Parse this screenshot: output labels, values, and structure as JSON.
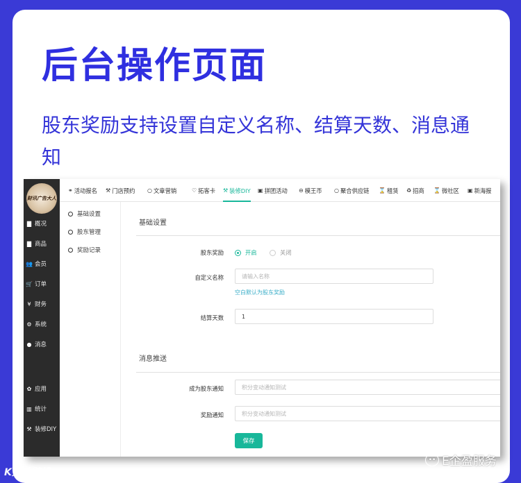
{
  "headline": "后台操作页面",
  "subline": "股东奖励支持设置自定义名称、结算天数、消息通知",
  "logo_text": "财讯广告大人",
  "sidebar": {
    "items": [
      {
        "label": "概况",
        "icon": "overview-icon",
        "glyph": "▇"
      },
      {
        "label": "商品",
        "icon": "goods-icon",
        "glyph": "▇"
      },
      {
        "label": "会员",
        "icon": "members-icon",
        "glyph": "👥"
      },
      {
        "label": "订单",
        "icon": "cart-icon",
        "glyph": "🛒"
      },
      {
        "label": "财务",
        "icon": "yen-icon",
        "glyph": "¥"
      },
      {
        "label": "系统",
        "icon": "gear-icon",
        "glyph": "⚙"
      },
      {
        "label": "消息",
        "icon": "chat-icon",
        "glyph": "●"
      },
      {
        "label": "应用",
        "icon": "apps-icon",
        "glyph": "✿"
      },
      {
        "label": "统计",
        "icon": "bar-chart-icon",
        "glyph": "▥"
      },
      {
        "label": "装修DIY",
        "icon": "hammer-icon",
        "glyph": "⚒"
      }
    ]
  },
  "tabs": [
    {
      "label": "活动报名",
      "icon": "link-icon",
      "glyph": "⚭"
    },
    {
      "label": "门店预约",
      "icon": "hammer-icon",
      "glyph": "⚒"
    },
    {
      "label": "文章营销",
      "icon": "circle-icon",
      "glyph": "○"
    },
    {
      "label": "拓客卡",
      "icon": "heart-icon",
      "glyph": "♡"
    },
    {
      "label": "装修DIY",
      "icon": "hammer-icon",
      "glyph": "⚒",
      "active": true
    },
    {
      "label": "拼团活动",
      "icon": "image-icon",
      "glyph": "▣"
    },
    {
      "label": "模王币",
      "icon": "coin-icon",
      "glyph": "⊖"
    },
    {
      "label": "聚合供应链",
      "icon": "circle-icon",
      "glyph": "○"
    },
    {
      "label": "租赁",
      "icon": "hourglass-icon",
      "glyph": "⌛"
    },
    {
      "label": "招商",
      "icon": "recycle-icon",
      "glyph": "♻"
    },
    {
      "label": "微社区",
      "icon": "hourglass-icon",
      "glyph": "⌛"
    },
    {
      "label": "新海报",
      "icon": "image-icon",
      "glyph": "▣"
    }
  ],
  "subnav": [
    "基础设置",
    "股东管理",
    "奖励记录"
  ],
  "basic": {
    "title": "基础设置",
    "reward_label": "股东奖励",
    "on_label": "开启",
    "off_label": "关闭",
    "name_label": "自定义名称",
    "name_placeholder": "请输入名称",
    "name_hint": "空白默认为股东奖励",
    "days_label": "结算天数",
    "days_value": "1"
  },
  "push": {
    "title": "消息推送",
    "become_label": "成为股东通知",
    "become_value": "积分变动通知测试",
    "reward_label": "奖励通知",
    "reward_value": "积分变动通知测试"
  },
  "save_label": "保存",
  "watermark_left": "K大数跨境",
  "watermark_right": "E企盈服务",
  "colors": {
    "accent": "#18b79a",
    "brand_blue": "#3a3ad6"
  }
}
